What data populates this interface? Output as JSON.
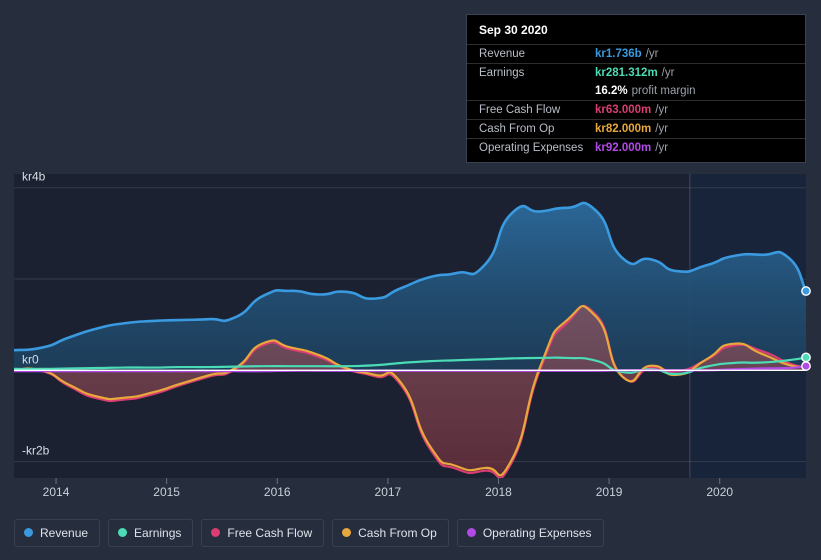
{
  "colors": {
    "page_bg": "#262d3d",
    "plot_bg": "#1b2130",
    "plot_bg_band": "#18243a",
    "grid": "#555c6b",
    "zero_line": "#ffffff",
    "revenue": "#3a9ae0",
    "earnings": "#4bdbb5",
    "free_cash_flow": "#d93d72",
    "cash_from_op": "#e8a83c",
    "operating_expenses": "#b24ae8"
  },
  "tooltip": {
    "date": "Sep 30 2020",
    "rows": [
      {
        "key": "Revenue",
        "value": "kr1.736b",
        "suffix": "/yr",
        "color": "#3a9ae0"
      },
      {
        "key": "Earnings",
        "value": "kr281.312m",
        "suffix": "/yr",
        "color": "#4bdbb5"
      },
      {
        "key": "",
        "value": "16.2%",
        "suffix": "profit margin",
        "color": "#ffffff"
      },
      {
        "key": "Free Cash Flow",
        "value": "kr63.000m",
        "suffix": "/yr",
        "color": "#d93d72"
      },
      {
        "key": "Cash From Op",
        "value": "kr82.000m",
        "suffix": "/yr",
        "color": "#e8a83c"
      },
      {
        "key": "Operating Expenses",
        "value": "kr92.000m",
        "suffix": "/yr",
        "color": "#b24ae8"
      }
    ]
  },
  "legend": {
    "items": [
      {
        "label": "Revenue",
        "color": "#3a9ae0"
      },
      {
        "label": "Earnings",
        "color": "#4bdbb5"
      },
      {
        "label": "Free Cash Flow",
        "color": "#d93d72"
      },
      {
        "label": "Cash From Op",
        "color": "#e8a83c"
      },
      {
        "label": "Operating Expenses",
        "color": "#b24ae8"
      }
    ]
  },
  "chart_data": {
    "type": "area",
    "title": "",
    "xlabel": "",
    "ylabel": "",
    "currency": "kr",
    "period": "/yr",
    "grid": true,
    "legend_position": "bottom",
    "xlim": [
      2013.62,
      2020.78
    ],
    "ylim": [
      -2.36,
      4.3
    ],
    "yticks": [
      4,
      0,
      -2
    ],
    "ytick_labels": [
      "kr4b",
      "kr0",
      "-kr2b"
    ],
    "gridlines": [
      4,
      2,
      0,
      -2
    ],
    "xticks": [
      2014,
      2015,
      2016,
      2017,
      2018,
      2019,
      2020
    ],
    "xtick_labels": [
      "2014",
      "2015",
      "2016",
      "2017",
      "2018",
      "2019",
      "2020"
    ],
    "units": "billions kr",
    "forecast_divider_x": 2019.73,
    "x": [
      2013.62,
      2013.88,
      2014.12,
      2014.38,
      2014.62,
      2014.88,
      2015.12,
      2015.38,
      2015.62,
      2015.88,
      2016.12,
      2016.38,
      2016.62,
      2016.88,
      2017.12,
      2017.38,
      2017.62,
      2017.88,
      2018.12,
      2018.38,
      2018.62,
      2018.88,
      2019.12,
      2019.38,
      2019.62,
      2019.88,
      2020.12,
      2020.38,
      2020.62,
      2020.78
    ],
    "series": [
      {
        "name": "Revenue",
        "color": "#3a9ae0",
        "filled": true,
        "values": [
          0.44,
          0.5,
          0.72,
          0.92,
          1.03,
          1.08,
          1.1,
          1.12,
          1.16,
          1.64,
          1.74,
          1.66,
          1.72,
          1.57,
          1.8,
          2.04,
          2.13,
          2.32,
          3.44,
          3.48,
          3.56,
          3.5,
          2.46,
          2.43,
          2.17,
          2.3,
          2.5,
          2.53,
          2.47,
          1.736
        ]
      },
      {
        "name": "Earnings",
        "color": "#4bdbb5",
        "filled": false,
        "values": [
          0.03,
          0.03,
          0.04,
          0.05,
          0.06,
          0.06,
          0.07,
          0.07,
          0.08,
          0.09,
          0.09,
          0.09,
          0.09,
          0.11,
          0.16,
          0.2,
          0.22,
          0.24,
          0.26,
          0.27,
          0.27,
          0.21,
          -0.04,
          0.02,
          -0.08,
          0.08,
          0.16,
          0.17,
          0.22,
          0.281312
        ]
      },
      {
        "name": "Free Cash Flow",
        "color": "#d93d72",
        "filled": true,
        "values": [
          -0.01,
          -0.02,
          -0.35,
          -0.62,
          -0.64,
          -0.52,
          -0.33,
          -0.14,
          0.02,
          0.56,
          0.46,
          0.29,
          0.03,
          -0.13,
          -0.33,
          -1.72,
          -2.16,
          -2.2,
          -2.02,
          0.04,
          1.04,
          1.22,
          -0.13,
          0.06,
          -0.02,
          0.23,
          0.54,
          0.42,
          0.16,
          0.063
        ]
      },
      {
        "name": "Cash From Op",
        "color": "#e8a83c",
        "filled": true,
        "values": [
          0.01,
          -0.01,
          -0.32,
          -0.58,
          -0.6,
          -0.48,
          -0.3,
          -0.11,
          0.05,
          0.6,
          0.5,
          0.33,
          0.05,
          -0.1,
          -0.28,
          -1.66,
          -2.1,
          -2.14,
          -1.96,
          0.1,
          1.1,
          1.18,
          -0.14,
          0.1,
          -0.1,
          0.24,
          0.58,
          0.36,
          0.12,
          0.082
        ]
      },
      {
        "name": "Operating Expenses",
        "color": "#b24ae8",
        "filled": false,
        "values": [
          -0.02,
          -0.02,
          -0.02,
          -0.02,
          -0.02,
          -0.02,
          -0.02,
          -0.02,
          -0.02,
          -0.02,
          -0.01,
          -0.01,
          -0.01,
          -0.01,
          -0.01,
          -0.01,
          -0.01,
          -0.01,
          -0.01,
          -0.01,
          -0.01,
          -0.01,
          0.0,
          0.0,
          0.0,
          0.0,
          0.02,
          0.04,
          0.05,
          0.092
        ]
      }
    ],
    "endpoint_markers": [
      {
        "name": "Revenue",
        "color": "#3a9ae0"
      },
      {
        "name": "Earnings",
        "color": "#4bdbb5"
      },
      {
        "name": "Operating Expenses",
        "color": "#b24ae8"
      }
    ]
  }
}
